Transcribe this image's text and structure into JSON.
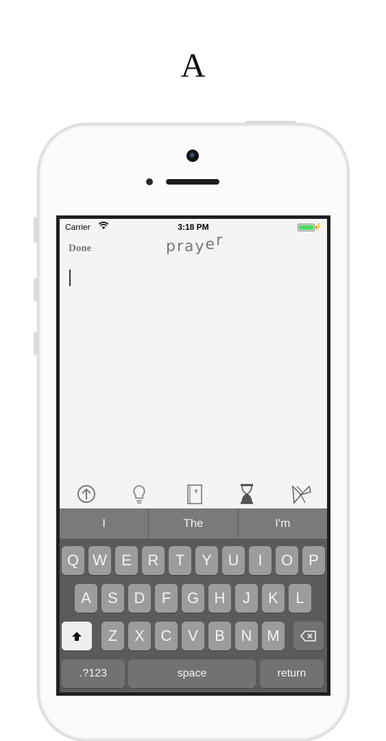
{
  "figure_label": "A",
  "status_bar": {
    "carrier": "Carrier",
    "time": "3:18 PM"
  },
  "nav": {
    "done_label": "Done",
    "title": "prayer"
  },
  "toolbar": {
    "icons": [
      "upload-arrow-icon",
      "lightbulb-icon",
      "book-icon",
      "hourglass-icon",
      "origami-bird-icon"
    ]
  },
  "keyboard": {
    "suggestions": [
      "I",
      "The",
      "I'm"
    ],
    "rows": [
      [
        "Q",
        "W",
        "E",
        "R",
        "T",
        "Y",
        "U",
        "I",
        "O",
        "P"
      ],
      [
        "A",
        "S",
        "D",
        "F",
        "G",
        "H",
        "J",
        "K",
        "L"
      ],
      [
        "Z",
        "X",
        "C",
        "V",
        "B",
        "N",
        "M"
      ]
    ],
    "numbers_label": ".?123",
    "space_label": "space",
    "return_label": "return"
  },
  "colors": {
    "keyboard_bg": "#5b5b5b",
    "key": "#9c9c9c",
    "battery": "#4cd964"
  }
}
